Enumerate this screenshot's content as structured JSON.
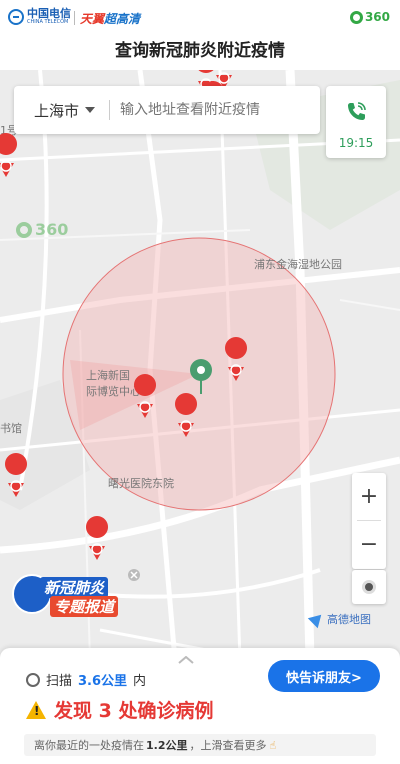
{
  "brand": {
    "telecom_cn": "中国电信",
    "telecom_en": "CHINA TELECOM",
    "tianyi": "天翼",
    "tianyi_hd": "超高清",
    "logo_360": "360"
  },
  "page_title": "查询新冠肺炎附近疫情",
  "search": {
    "city": "上海市",
    "placeholder": "输入地址查看附近疫情"
  },
  "phone": {
    "icon": "phone-icon",
    "time": "19:15"
  },
  "map": {
    "watermark": "360",
    "labels": {
      "wetland_park": "浦东金海湿地公园",
      "expo_center_1": "上海新国",
      "expo_center_2": "际博览中心",
      "hospital": "曙光医院东院",
      "library": "书馆",
      "left_edge": "1号"
    },
    "zoom_in": "+",
    "zoom_out": "−",
    "attribution": "高德地图",
    "special_line1": "新冠肺炎",
    "special_line2": "专题报道",
    "colors": {
      "pin": "#e53935",
      "center_pin": "#4a9d6f",
      "radius_fill": "#f4b6b6"
    }
  },
  "panel": {
    "scan_prefix": "扫描",
    "scan_km": "3.6公里",
    "scan_suffix": "内",
    "share_button": "快告诉朋友>",
    "found_text": "发现 3 处确诊病例",
    "nearest_prefix": "离你最近的一处疫情在",
    "nearest_km": "1.2公里",
    "nearest_suffix": "，上滑查看更多"
  }
}
